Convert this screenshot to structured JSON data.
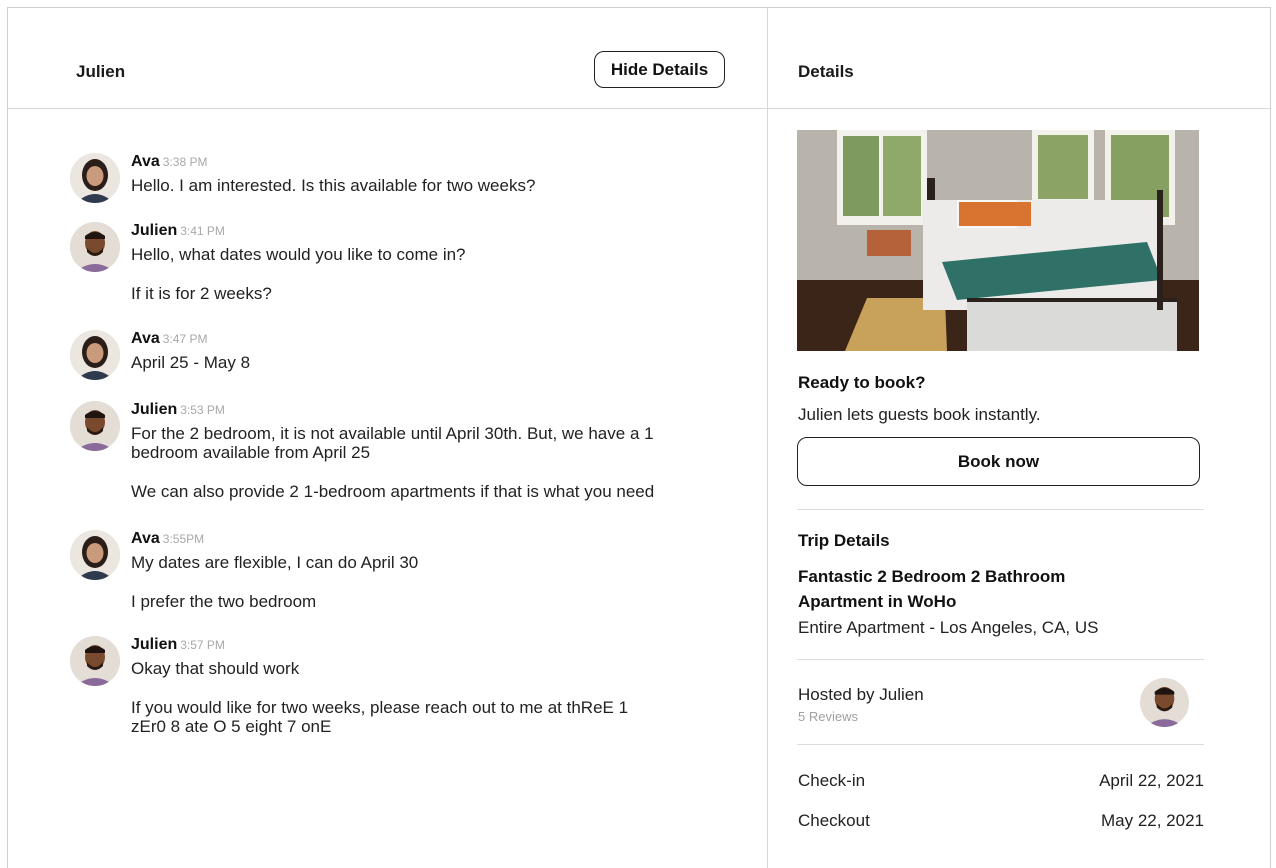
{
  "conversation": {
    "title": "Julien",
    "hide_details_label": "Hide Details"
  },
  "details": {
    "title": "Details",
    "ready_heading": "Ready to book?",
    "ready_text": "Julien lets guests book instantly.",
    "book_now_label": "Book now",
    "trip_heading": "Trip Details",
    "listing_title_line1": "Fantastic 2 Bedroom 2 Bathroom",
    "listing_title_line2": "Apartment in WoHo",
    "listing_subtitle": "Entire Apartment - Los Angeles, CA, US",
    "hosted_by": "Hosted by Julien",
    "reviews": "5 Reviews",
    "checkin_label": "Check-in",
    "checkin_value": "April 22, 2021",
    "checkout_label": "Checkout",
    "checkout_value": "May 22, 2021"
  },
  "messages": [
    {
      "sender": "Ava",
      "time": "3:38 PM",
      "lines": [
        "Hello.  I am interested.  Is this available for two weeks?"
      ]
    },
    {
      "sender": "Julien",
      "time": "3:41 PM",
      "lines": [
        "Hello, what dates would you like to come in?",
        "If it is for 2 weeks?"
      ]
    },
    {
      "sender": "Ava",
      "time": "3:47 PM",
      "lines": [
        "April 25 - May 8"
      ]
    },
    {
      "sender": "Julien",
      "time": "3:53 PM",
      "lines": [
        "For the 2 bedroom, it is not available until April 30th.  But, we have a 1",
        "bedroom available from April 25",
        "We can also provide 2 1-bedroom apartments if that is what you need"
      ]
    },
    {
      "sender": "Ava",
      "time": "3:55PM",
      "lines": [
        "My dates are flexible, I can do April 30",
        "I prefer the two bedroom"
      ]
    },
    {
      "sender": "Julien",
      "time": "3:57 PM",
      "lines": [
        "Okay that should work",
        "If you would like for two weeks, please reach out to me at thReE 1",
        "zEr0 8 ate O 5 eight 7 onE"
      ]
    }
  ]
}
